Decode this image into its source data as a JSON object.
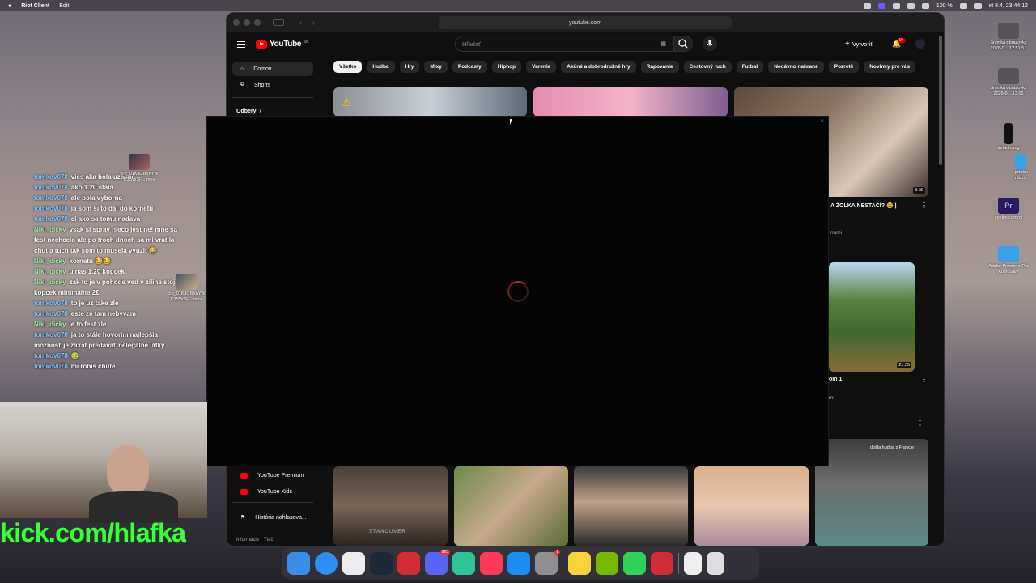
{
  "menubar": {
    "app": "Riot Client",
    "menu_edit": "Edit",
    "battery": "100 %",
    "datetime": "st 8.4.  23:44:12"
  },
  "browser": {
    "url": "youtube.com"
  },
  "youtube": {
    "logo": "YouTube",
    "region": "SK",
    "search_placeholder": "Hľadať",
    "create_label": "Vytvoriť",
    "notif_badge": "9+",
    "sidebar": {
      "home": "Domov",
      "shorts": "Shorts",
      "subscriptions": "Odbery",
      "premium": "YouTube Premium",
      "kids": "YouTube Kids",
      "report": "História nahlasova...",
      "footer_info": "Informácie",
      "footer_press": "Tlač"
    },
    "chips": [
      "Všetko",
      "Hudba",
      "Hry",
      "Mixy",
      "Podcasty",
      "Hiphop",
      "Varenie",
      "Akčné a dobrodružné hry",
      "Rapovanie",
      "Cestovný ruch",
      "Futbal",
      "Nedávno nahrané",
      "Pozreté",
      "Novinky pre vás"
    ],
    "videos": {
      "v3_duration": "9:58",
      "v3_title": "A ŽOLKA NESTAČÍ? 😂 |",
      "v3_sub": "nami",
      "v4_duration": "21:25",
      "v4_title": "om 1",
      "v4_sub": "mi",
      "short1_overlay": "STANCUVER",
      "short5_overlay": "došla hudba z Francie"
    }
  },
  "chat": [
    {
      "user": "tomkov078",
      "msg": "vies aka bola uzasna",
      "color": "blue"
    },
    {
      "user": "tomkov078",
      "msg": "ako 1.20 stala",
      "color": "blue"
    },
    {
      "user": "tomkov078",
      "msg": "ale bola vyborna",
      "color": "blue"
    },
    {
      "user": "tomkov078",
      "msg": "ja som si to dal do kornetu",
      "color": "blue"
    },
    {
      "user": "tomkov078",
      "msg": "ci ako sa tomu nadava",
      "color": "blue"
    },
    {
      "user": "Niki_dicky",
      "msg": "vsak si sprav nieco jest ne! mne sa fest nechcelo ale po troch dnoch sa mi vratila chut a tuch tak som to musela vyuzit 😂",
      "color": "green"
    },
    {
      "user": "Niki_dicky",
      "msg": "kornetu 😂😂",
      "color": "green"
    },
    {
      "user": "Niki_dicky",
      "msg": "u nas 1.20 kopcek",
      "color": "green"
    },
    {
      "user": "Niki_dicky",
      "msg": "zak to je v pohode ved v ziline stoji kopcek minimalne 2€",
      "color": "green"
    },
    {
      "user": "tomkov078",
      "msg": "to je uz take zle",
      "color": "blue"
    },
    {
      "user": "tomkov078",
      "msg": "este ze tam nebyvam",
      "color": "blue"
    },
    {
      "user": "Niki_dicky",
      "msg": "je to fest zle",
      "color": "green"
    },
    {
      "user": "tomkov078",
      "msg": "ja to stále hovorim najlepšia možnosť je zaxat predávať nelegálne látky",
      "color": "blue"
    },
    {
      "user": "tomkov078",
      "msg": "🤢",
      "color": "blue"
    },
    {
      "user": "tomkov078",
      "msg": "mi robis chute",
      "color": "blue"
    }
  ],
  "stream": {
    "kick_url": "kick.com/hlafka"
  },
  "desktop": {
    "icons": [
      {
        "label": "Snímka obrazovky 2026-0....12.51.51"
      },
      {
        "label": "Snímka obrazovky 2026-0....13.06"
      },
      {
        "label": "default.png"
      },
      {
        "label": "cooking.prproj"
      },
      {
        "label": "Adobe Premiere Pro Auto-Save"
      }
    ],
    "clip_label_1": "clip_01KJGBYAYW K9SWSF....mov",
    "clip_label_2": "clip_01KJGBYAYW K9SWSF....mov",
    "premiere_label": "Pr",
    "folder_partial": "priečin názo"
  },
  "dock": {
    "discord_badge": "223",
    "settings_badge": "1"
  }
}
